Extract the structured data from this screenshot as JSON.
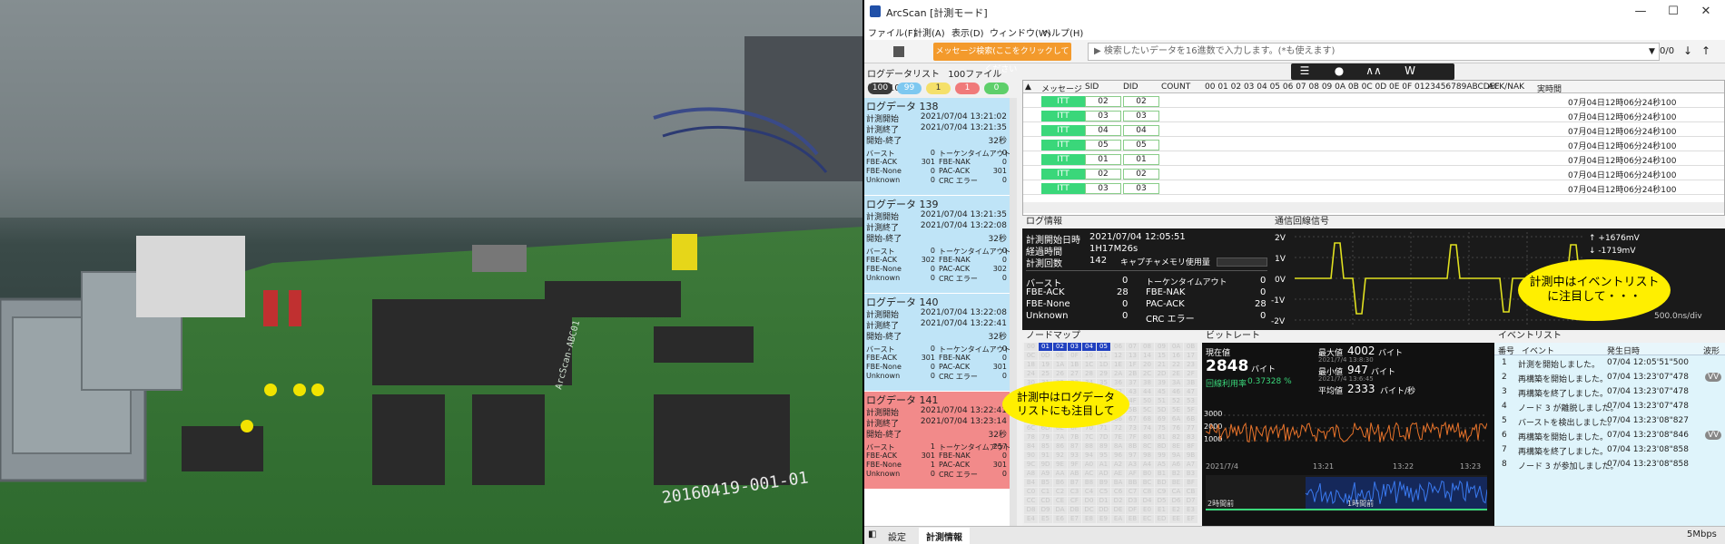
{
  "photo": {
    "board_label": "20160419-001-01",
    "silk_text": "ArcScan-ABC01"
  },
  "window": {
    "title": "ArcScan [計測モード]",
    "controls": [
      "—",
      "☐",
      "✕"
    ]
  },
  "menu": [
    "ファイル(F)",
    "計測(A)",
    "表示(D)",
    "ウィンドウ(W)",
    "ヘルプ(H)"
  ],
  "toolbar": {
    "message_search": "メッセージ検索(ここをクリックしてください)",
    "search_placeholder": "検索したいデータを16進数で入力します。(*も使えます)",
    "search_count": "0/0"
  },
  "loglist": {
    "header": "ログデータリスト",
    "count_text": "100ファイル(最大100)",
    "badges": [
      {
        "value": "100",
        "color": "#3a3a3a"
      },
      {
        "value": "99",
        "color": "#7ec8f0"
      },
      {
        "value": "1",
        "color": "#f5e06a"
      },
      {
        "value": "1",
        "color": "#f07a7a"
      },
      {
        "value": "0",
        "color": "#5ecf6a"
      }
    ],
    "entries": [
      {
        "name": "ログデータ 138",
        "start": "2021/07/04 13:21:02",
        "end": "2021/07/04 13:21:35",
        "duration": "32秒",
        "burst": "0",
        "timeout": "0",
        "fbe_ack": "301",
        "fbe_nak": "0",
        "fbe_none": "0",
        "pac_ack": "301",
        "unknown": "0",
        "crc": "0",
        "color": "#bfe4f7"
      },
      {
        "name": "ログデータ 139",
        "start": "2021/07/04 13:21:35",
        "end": "2021/07/04 13:22:08",
        "duration": "32秒",
        "burst": "0",
        "timeout": "0",
        "fbe_ack": "302",
        "fbe_nak": "0",
        "fbe_none": "0",
        "pac_ack": "302",
        "unknown": "0",
        "crc": "0",
        "color": "#bfe4f7"
      },
      {
        "name": "ログデータ 140",
        "start": "2021/07/04 13:22:08",
        "end": "2021/07/04 13:22:41",
        "duration": "32秒",
        "burst": "0",
        "timeout": "0",
        "fbe_ack": "301",
        "fbe_nak": "0",
        "fbe_none": "0",
        "pac_ack": "301",
        "unknown": "0",
        "crc": "0",
        "color": "#bfe4f7"
      },
      {
        "name": "ログデータ 141",
        "start": "2021/07/04 13:22:41",
        "end": "2021/07/04 13:23:14",
        "duration": "32秒",
        "burst": "1",
        "timeout": "257",
        "fbe_ack": "301",
        "fbe_nak": "0",
        "fbe_none": "1",
        "pac_ack": "301",
        "unknown": "0",
        "crc": "0",
        "color": "#f28a8a"
      }
    ],
    "labels": {
      "start": "計測開始",
      "end": "計測終了",
      "duration": "開始-終了",
      "burst": "バースト",
      "timeout": "トーケンタイムアウト",
      "fbe_ack": "FBE-ACK",
      "fbe_nak": "FBE-NAK",
      "fbe_none": "FBE-None",
      "pac_ack": "PAC-ACK",
      "unknown": "Unknown",
      "crc": "CRC エラー"
    }
  },
  "message_table": {
    "headers": [
      "メッセージ",
      "SID",
      "DID",
      "COUNT",
      "00 01 02 03 04 05 06 07 08 09 0A 0B 0C 0D 0E 0F  0123456789ABCDEF",
      "ACK/NAK",
      "実時間"
    ],
    "rows": [
      {
        "msg": "ITT",
        "sid": "02",
        "did": "02",
        "time": "07月04日12時06分24秒100"
      },
      {
        "msg": "ITT",
        "sid": "03",
        "did": "03",
        "time": "07月04日12時06分24秒100"
      },
      {
        "msg": "ITT",
        "sid": "04",
        "did": "04",
        "time": "07月04日12時06分24秒100"
      },
      {
        "msg": "ITT",
        "sid": "05",
        "did": "05",
        "time": "07月04日12時06分24秒100"
      },
      {
        "msg": "ITT",
        "sid": "01",
        "did": "01",
        "time": "07月04日12時06分24秒100"
      },
      {
        "msg": "ITT",
        "sid": "02",
        "did": "02",
        "time": "07月04日12時06分24秒100"
      },
      {
        "msg": "ITT",
        "sid": "03",
        "did": "03",
        "time": "07月04日12時06分24秒100"
      }
    ]
  },
  "log_info": {
    "title": "ログ情報",
    "start_label": "計測開始日時",
    "start_value": "2021/07/04 12:05:51",
    "elapsed_label": "経過時間",
    "elapsed_value": "1H17M26s",
    "count_label": "計測回数",
    "count_value": "142",
    "capture_label": "キャプチャメモリ使用量",
    "burst_label": "バースト",
    "burst_value": "0",
    "timeout_label": "トーケンタイムアウト",
    "timeout_value": "0",
    "fbe_ack_label": "FBE-ACK",
    "fbe_ack_value": "28",
    "fbe_nak_label": "FBE-NAK",
    "fbe_nak_value": "0",
    "fbe_none_label": "FBE-None",
    "fbe_none_value": "0",
    "pac_ack_label": "PAC-ACK",
    "pac_ack_value": "28",
    "unknown_label": "Unknown",
    "unknown_value": "0",
    "crc_label": "CRC エラー",
    "crc_value": "0"
  },
  "signal": {
    "title": "通信回線信号",
    "yticks": [
      "2V",
      "1V",
      "0V",
      "-1V",
      "-2V"
    ],
    "max": "↑ +1676mV",
    "min": "↓ -1719mV",
    "timescale": "500.0ns/div"
  },
  "callouts": {
    "right": "計測中はイベントリスト\nに注目して・・・",
    "left": "計測中はログデータ\nリストにも注目して"
  },
  "nodemap": {
    "title": "ノードマップ",
    "active": [
      "01",
      "02",
      "03",
      "04",
      "05"
    ]
  },
  "bitrate": {
    "title": "ビットレート",
    "current_label": "現在値",
    "current_value": "2848",
    "current_unit": "バイト",
    "ratio_label": "回線利用率",
    "ratio_value": "0.37328 %",
    "max_label": "最大値",
    "max_value": "4002",
    "max_unit": "バイト",
    "max_time": "2021/7/4 13:8:30",
    "min_label": "最小値",
    "min_value": "947",
    "min_unit": "バイト",
    "min_time": "2021/7/4 13:6:45",
    "avg_label": "平均値",
    "avg_value": "2333",
    "avg_unit": "バイト/秒",
    "yticks": [
      "3000",
      "2000",
      "1000"
    ],
    "date": "2021/7/4",
    "xticks": [
      "13:21",
      "13:22",
      "13:23"
    ],
    "overview_left": "2時間前",
    "overview_mid": "1時間前"
  },
  "events": {
    "title": "イベントリスト",
    "headers": [
      "番号",
      "イベント",
      "発生日時",
      "波形"
    ],
    "rows": [
      {
        "no": "1",
        "event": "計測を開始しました。",
        "time": "07/04 12:05'51\"500",
        "wave": ""
      },
      {
        "no": "2",
        "event": "再構築を開始しました。",
        "time": "07/04 13:23'07\"478",
        "wave": "VV"
      },
      {
        "no": "3",
        "event": "再構築を終了しました。",
        "time": "07/04 13:23'07\"478",
        "wave": ""
      },
      {
        "no": "4",
        "event": "ノード 3 が離脱しました。",
        "time": "07/04 13:23'07\"478",
        "wave": ""
      },
      {
        "no": "5",
        "event": "バーストを検出しました。",
        "time": "07/04 13:23'08\"827",
        "wave": ""
      },
      {
        "no": "6",
        "event": "再構築を開始しました。",
        "time": "07/04 13:23'08\"846",
        "wave": "VV"
      },
      {
        "no": "7",
        "event": "再構築を終了しました。",
        "time": "07/04 13:23'08\"858",
        "wave": ""
      },
      {
        "no": "8",
        "event": "ノード 3 が参加しました。",
        "time": "07/04 13:23'08\"858",
        "wave": ""
      }
    ]
  },
  "bottom": {
    "tabs": [
      "設定",
      "計測情報"
    ],
    "speed": "5Mbps"
  }
}
